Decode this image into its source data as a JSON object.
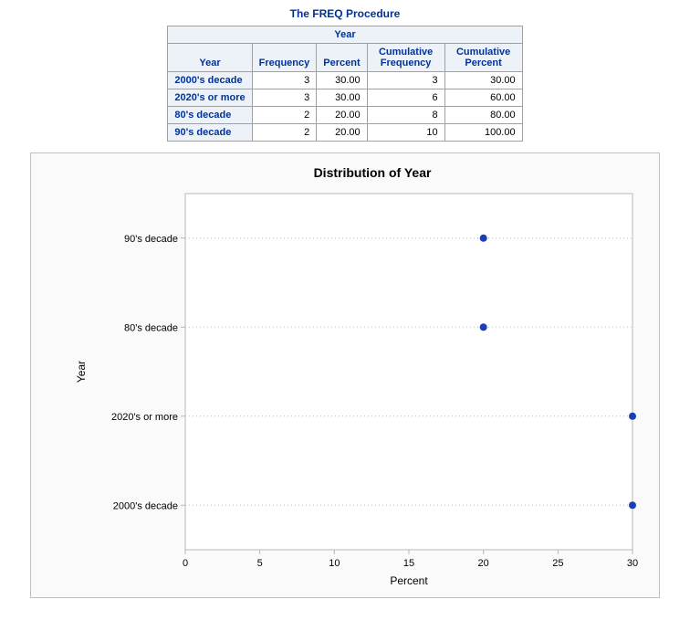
{
  "title": "The FREQ Procedure",
  "table": {
    "spanner": "Year",
    "headers": [
      "Year",
      "Frequency",
      "Percent",
      "Cumulative Frequency",
      "Cumulative Percent"
    ],
    "rows": [
      {
        "label": "2000's decade",
        "freq": "3",
        "pct": "30.00",
        "cfreq": "3",
        "cpct": "30.00"
      },
      {
        "label": "2020's or more",
        "freq": "3",
        "pct": "30.00",
        "cfreq": "6",
        "cpct": "60.00"
      },
      {
        "label": "80's decade",
        "freq": "2",
        "pct": "20.00",
        "cfreq": "8",
        "cpct": "80.00"
      },
      {
        "label": "90's decade",
        "freq": "2",
        "pct": "20.00",
        "cfreq": "10",
        "cpct": "100.00"
      }
    ]
  },
  "chart_data": {
    "type": "scatter",
    "title": "Distribution of Year",
    "xlabel": "Percent",
    "ylabel": "Year",
    "xlim": [
      0,
      30
    ],
    "x_ticks": [
      0,
      5,
      10,
      15,
      20,
      25,
      30
    ],
    "categories": [
      "90's decade",
      "80's decade",
      "2020's or more",
      "2000's decade"
    ],
    "values": [
      20,
      20,
      30,
      30
    ]
  }
}
